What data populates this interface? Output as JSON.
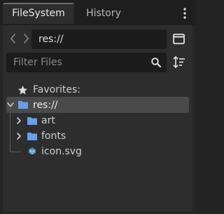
{
  "tabs": [
    {
      "label": "FileSystem",
      "active": true
    },
    {
      "label": "History",
      "active": false
    }
  ],
  "path": {
    "value": "res://"
  },
  "filter": {
    "placeholder": "Filter Files",
    "value": ""
  },
  "tree": {
    "favorites_label": "Favorites:",
    "root_label": "res://",
    "items": [
      {
        "label": "art",
        "type": "folder",
        "collapsed": true
      },
      {
        "label": "fonts",
        "type": "folder",
        "collapsed": true
      },
      {
        "label": "icon.svg",
        "type": "file"
      }
    ]
  },
  "colors": {
    "folder": "#6c9ee8",
    "selected": "#4a4a4a",
    "panel": "#2d2d2d"
  },
  "icons": {
    "menu": "vertical-ellipsis-icon",
    "back": "chevron-left-icon",
    "forward": "chevron-right-icon",
    "split": "split-view-icon",
    "search": "search-icon",
    "sort": "sort-icon",
    "favorites": "star-icon",
    "folder": "folder-icon",
    "svg_file": "svg-file-icon"
  }
}
